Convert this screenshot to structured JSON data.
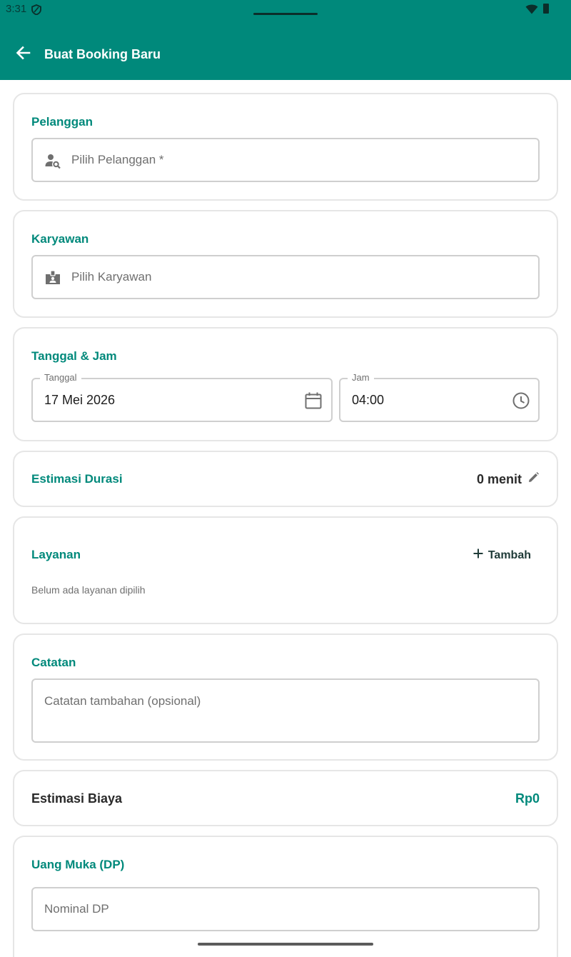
{
  "status_bar": {
    "time": "3:31"
  },
  "header": {
    "title": "Buat Booking Baru"
  },
  "customer": {
    "title": "Pelanggan",
    "placeholder": "Pilih Pelanggan *"
  },
  "employee": {
    "title": "Karyawan",
    "placeholder": "Pilih Karyawan"
  },
  "datetime": {
    "title": "Tanggal & Jam",
    "date_label": "Tanggal",
    "date_value": "17 Mei 2026",
    "time_label": "Jam",
    "time_value": "04:00"
  },
  "duration": {
    "title": "Estimasi Durasi",
    "value": "0 menit"
  },
  "services": {
    "title": "Layanan",
    "add_label": "Tambah",
    "empty_text": "Belum ada layanan dipilih"
  },
  "notes": {
    "title": "Catatan",
    "placeholder": "Catatan tambahan (opsional)"
  },
  "cost": {
    "label": "Estimasi Biaya",
    "value": "Rp0"
  },
  "down_payment": {
    "title": "Uang Muka (DP)",
    "placeholder": "Nominal DP"
  },
  "colors": {
    "primary": "#00897b",
    "border": "#cfcfcf",
    "card_border": "#e6e6e6"
  }
}
